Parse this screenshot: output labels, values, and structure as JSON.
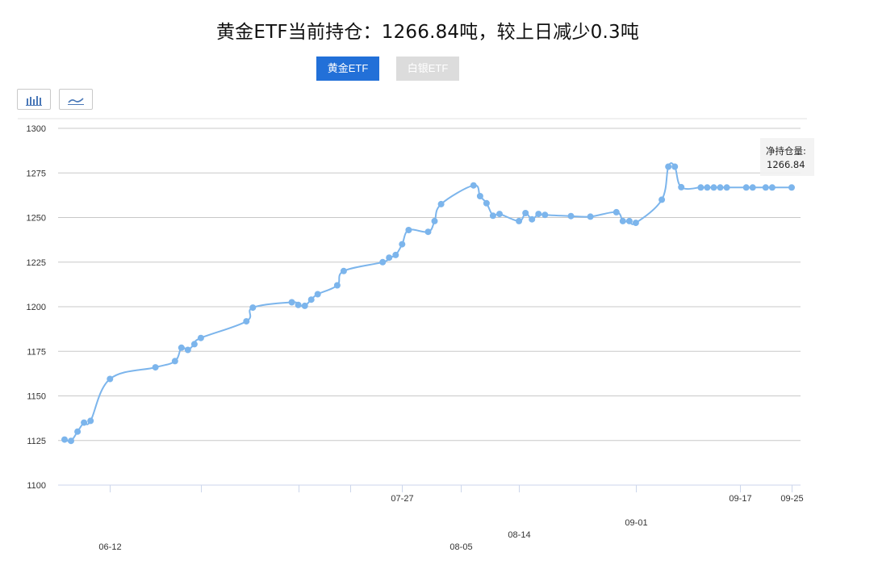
{
  "page_title": "黄金ETF当前持仓：1266.84吨，较上日减少0.3吨",
  "tabs": [
    {
      "label": "黄金ETF",
      "active": true
    },
    {
      "label": "白银ETF",
      "active": false
    }
  ],
  "toggles": [
    {
      "icon": "bar-chart-icon",
      "label": ""
    },
    {
      "icon": "line-chart-icon",
      "label": ""
    }
  ],
  "colors": {
    "accent": "#2270d8",
    "line": "#7cb5ec",
    "inactive_tab": "#dcdcdc"
  },
  "tooltip": {
    "label": "净持仓量:",
    "value": "1266.84"
  },
  "chart_data": {
    "type": "line",
    "title": "",
    "xlabel": "",
    "ylabel": "",
    "ylim": [
      1100,
      1300
    ],
    "yticks": [
      1100,
      1125,
      1150,
      1175,
      1200,
      1225,
      1250,
      1275,
      1300
    ],
    "xtick_labels": [
      "06-12",
      "07-27",
      "08-05",
      "08-14",
      "09-01",
      "09-17",
      "09-25"
    ],
    "grid": true,
    "series": [
      {
        "name": "",
        "x": [
          "06-05",
          "06-06",
          "06-07",
          "06-08",
          "06-09",
          "06-12",
          "06-19",
          "06-22",
          "06-23",
          "06-24",
          "06-25",
          "06-26",
          "07-03",
          "07-04",
          "07-10",
          "07-11",
          "07-12",
          "07-13",
          "07-14",
          "07-17",
          "07-18",
          "07-24",
          "07-25",
          "07-26",
          "07-27",
          "07-28",
          "07-31",
          "08-01",
          "08-02",
          "08-07",
          "08-08",
          "08-09",
          "08-10",
          "08-11",
          "08-14",
          "08-15",
          "08-16",
          "08-17",
          "08-18",
          "08-22",
          "08-25",
          "08-29",
          "08-30",
          "08-31",
          "09-01",
          "09-05",
          "09-06",
          "09-07",
          "09-08",
          "09-11",
          "09-12",
          "09-13",
          "09-14",
          "09-15",
          "09-18",
          "09-19",
          "09-21",
          "09-22",
          "09-25"
        ],
        "values": [
          1125.5,
          1124.8,
          1130,
          1135,
          1136,
          1159.5,
          1166,
          1169.5,
          1177,
          1175.8,
          1179,
          1182.5,
          1191.8,
          1199.5,
          1202.5,
          1201,
          1200.5,
          1204,
          1207,
          1212,
          1220,
          1225,
          1227.5,
          1229,
          1235,
          1243,
          1242,
          1248,
          1257.5,
          1268,
          1262,
          1258,
          1251,
          1252,
          1248,
          1252.5,
          1249,
          1252,
          1251.5,
          1250.8,
          1250.5,
          1253,
          1248,
          1248,
          1247,
          1260,
          1278.5,
          1278.5,
          1267,
          1266.84,
          1266.84,
          1266.84,
          1266.84,
          1266.84,
          1266.84,
          1266.84,
          1266.84,
          1266.84,
          1266.84
        ]
      }
    ]
  }
}
